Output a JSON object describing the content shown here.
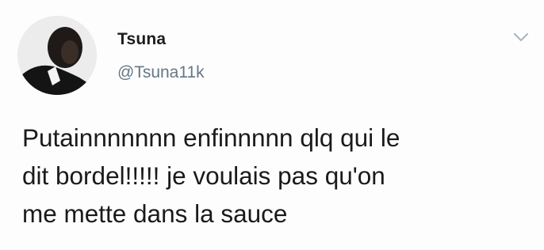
{
  "tweet": {
    "display_name": "Tsuna",
    "handle": "@Tsuna11k",
    "text": "Putainnnnnnn enfinnnnn qlq qui le\ndit bordel!!!!! je voulais pas qu'on\nme mette dans la sauce",
    "avatar_icon": "profile-photo",
    "menu_icon": "chevron-down-icon"
  },
  "colors": {
    "background": "#fdfdfd",
    "name": "#1c1c1c",
    "handle": "#657786",
    "text": "#1a1a1a",
    "caret": "#aab8c2"
  }
}
